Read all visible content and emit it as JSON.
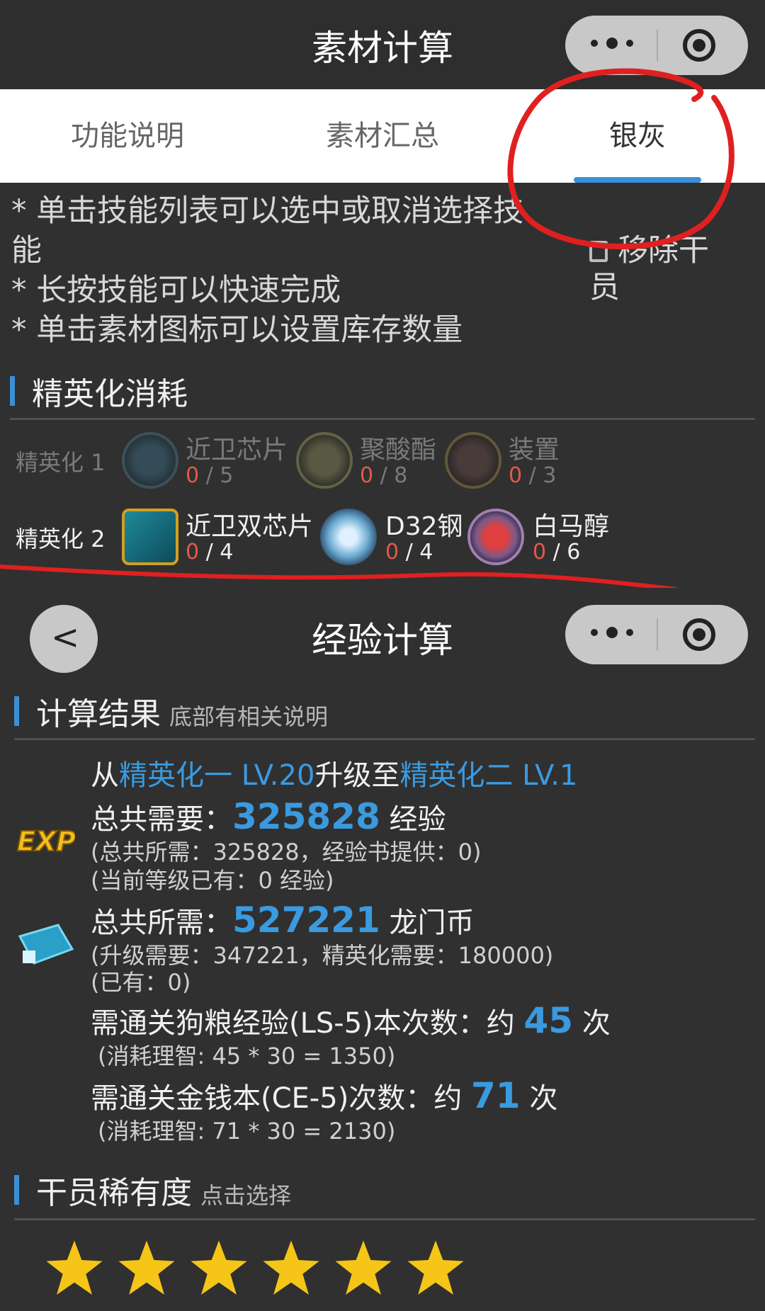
{
  "top_nav": {
    "title": "素材计算"
  },
  "tabs": [
    {
      "label": "功能说明"
    },
    {
      "label": "素材汇总"
    },
    {
      "label": "银灰"
    }
  ],
  "hints": {
    "line1": "* 单击技能列表可以选中或取消选择技",
    "line1b": "能",
    "line2": "* 长按技能可以快速完成",
    "line3": "* 单击素材图标可以设置库存数量",
    "remove_label": "移除干",
    "remove_label2": "员"
  },
  "elite_section": {
    "title": "精英化消耗",
    "rows": [
      {
        "label": "精英化 1",
        "materials": [
          {
            "name": "近卫芯片",
            "have": "0",
            "need": "5"
          },
          {
            "name": "聚酸酯",
            "have": "0",
            "need": "8"
          },
          {
            "name": "装置",
            "have": "0",
            "need": "3"
          }
        ]
      },
      {
        "label": "精英化 2",
        "materials": [
          {
            "name": "近卫双芯片",
            "have": "0",
            "need": "4"
          },
          {
            "name": "D32钢",
            "have": "0",
            "need": "4"
          },
          {
            "name": "白马醇",
            "have": "0",
            "need": "6"
          }
        ]
      }
    ]
  },
  "exp_nav": {
    "title": "经验计算",
    "back_icon": "chevron-left-icon"
  },
  "result": {
    "title": "计算结果",
    "subtitle": "底部有相关说明",
    "from_prefix": "从",
    "from": "精英化一 LV.20",
    "mid": "升级至",
    "to": "精英化二 LV.1",
    "exp_prefix": "总共需要：",
    "exp_total": "325828",
    "exp_unit": "经验",
    "exp_detail": "(总共所需：325828，经验书提供：0)",
    "exp_have": "(当前等级已有：0 经验)",
    "coin_prefix": "总共所需：",
    "coin_total": "527221",
    "coin_unit": "龙门币",
    "coin_detail": "(升级需要：347221，精英化需要：180000)",
    "coin_have": "(已有：0)",
    "ls_prefix": "需通关狗粮经验(LS-5)本次数：约",
    "ls_count": "45",
    "ls_unit": "次",
    "ls_detail": "(消耗理智: 45 * 30 = 1350)",
    "ce_prefix": "需通关金钱本(CE-5)次数：约",
    "ce_count": "71",
    "ce_unit": "次",
    "ce_detail": "(消耗理智: 71 * 30 = 2130)"
  },
  "rarity": {
    "title": "干员稀有度",
    "subtitle": "点击选择",
    "stars": 6
  },
  "colors": {
    "accent": "#3a8fd8",
    "have_red": "#e05a4a",
    "annotation": "#e02020",
    "star": "#f5c518"
  }
}
